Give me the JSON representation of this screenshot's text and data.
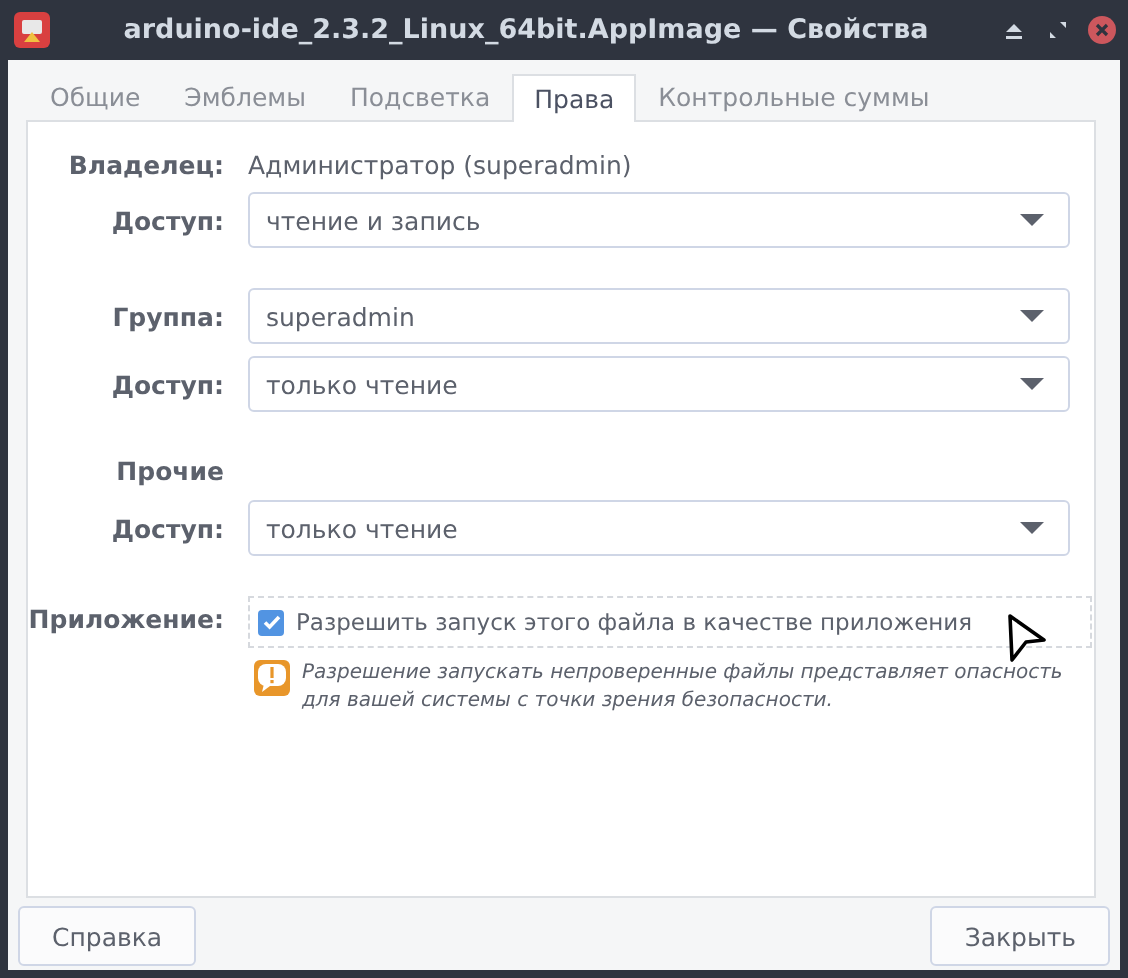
{
  "window": {
    "title": "arduino-ide_2.3.2_Linux_64bit.AppImage — Свойства"
  },
  "tabs": [
    {
      "label": "Общие",
      "selected": false
    },
    {
      "label": "Эмблемы",
      "selected": false
    },
    {
      "label": "Подсветка",
      "selected": false
    },
    {
      "label": "Права",
      "selected": true
    },
    {
      "label": "Контрольные суммы",
      "selected": false
    }
  ],
  "groups": [
    {
      "rows": [
        {
          "kind": "text",
          "label": "Владелец:",
          "value": "Администратор (superadmin)"
        },
        {
          "kind": "combo",
          "label": "Доступ:",
          "value": "чтение и запись"
        }
      ]
    },
    {
      "rows": [
        {
          "kind": "combo",
          "label": "Группа:",
          "value": "superadmin"
        },
        {
          "kind": "combo",
          "label": "Доступ:",
          "value": "только чтение"
        }
      ]
    },
    {
      "rows": [
        {
          "kind": "heading",
          "label": "Прочие"
        },
        {
          "kind": "combo",
          "label": "Доступ:",
          "value": "только чтение"
        }
      ]
    },
    {
      "rows": [
        {
          "kind": "checkbox",
          "label": "Приложение:",
          "text": "Разрешить запуск этого файла в качестве приложения",
          "checked": true,
          "note": "Разрешение запускать непроверенные файлы представляет опасность для вашей системы с точки зрения безопасности."
        }
      ]
    }
  ],
  "buttons": [
    "Справка",
    "Закрыть"
  ]
}
